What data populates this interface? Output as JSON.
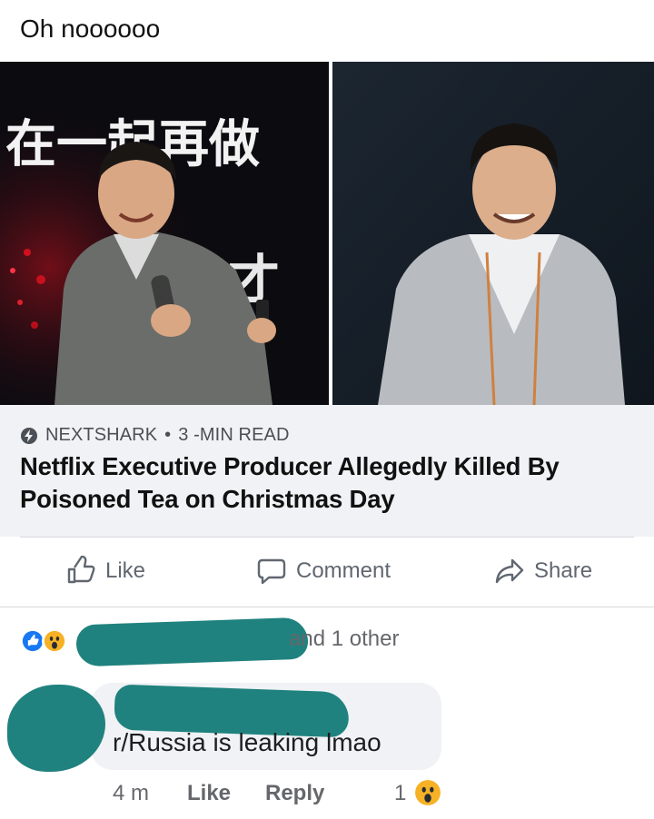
{
  "post": {
    "text": "Oh noooooo"
  },
  "link_card": {
    "source": "NEXTSHARK",
    "separator": "•",
    "read_time": "3 -MIN READ",
    "headline": "Netflix Executive Producer Allegedly Killed By Poisoned Tea on Christmas Day",
    "photo_left_banner_text": "在一起再做"
  },
  "actions": {
    "like": "Like",
    "comment": "Comment",
    "share": "Share"
  },
  "reactions": {
    "icons": [
      "like-reaction-icon",
      "wow-reaction-icon"
    ],
    "others_text": "and 1 other"
  },
  "comment": {
    "text": "r/Russia is leaking lmao",
    "time": "4 m",
    "like_label": "Like",
    "reply_label": "Reply",
    "reaction_count": "1"
  },
  "colors": {
    "redaction": "#20827e",
    "fb_blue": "#1877f2",
    "wow_yellow": "#f7b125",
    "card_bg": "#f0f2f5"
  }
}
